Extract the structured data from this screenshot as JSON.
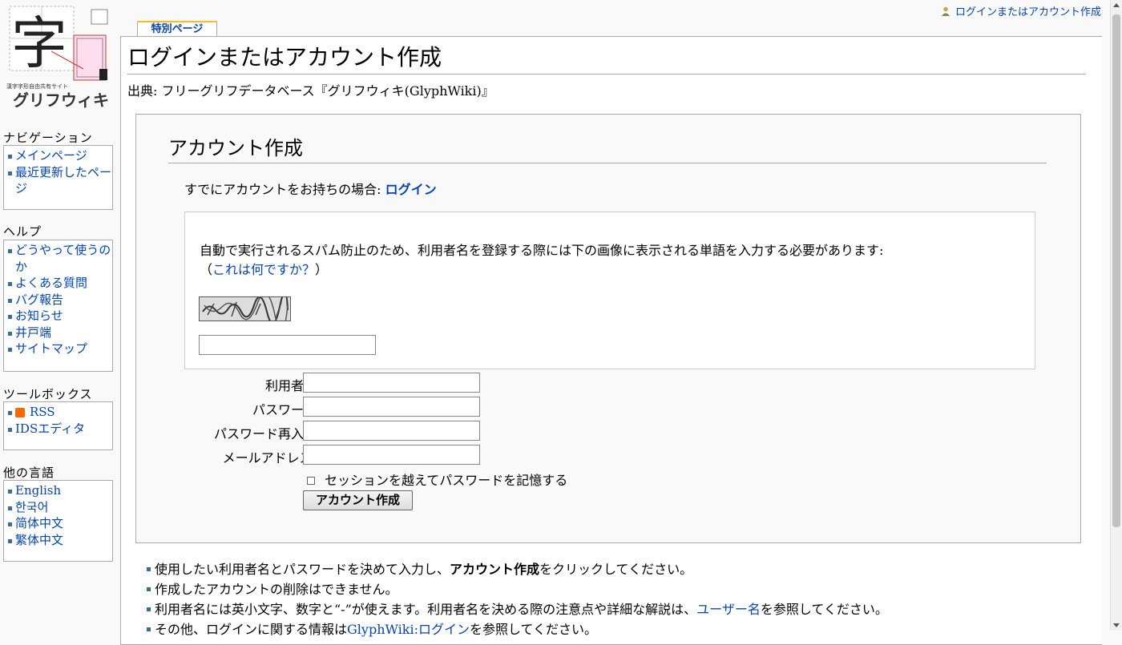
{
  "personal_tools": {
    "login_label": "ログインまたはアカウント作成"
  },
  "logo": {
    "big_char": "字",
    "subtitle": "漢字字形自由共有サイト",
    "name": "グリフウィキ"
  },
  "tabs": {
    "special": "特別ページ"
  },
  "page": {
    "title": "ログインまたはアカウント作成",
    "site_sub": "出典: フリーグリフデータベース『グリフウィキ(GlyphWiki)』"
  },
  "form": {
    "heading": "アカウント作成",
    "have_account_text": "すでにアカウントをお持ちの場合: ",
    "login_link": "ログイン",
    "captcha_text": "自動で実行されるスパム防止のため、利用者名を登録する際には下の画像に表示される単語を入力する必要があります:",
    "captcha_open": "（",
    "captcha_link": "これは何ですか？",
    "captcha_close": "）",
    "username_label": "利用者名",
    "password_label": "パスワード",
    "password_retype_label": "パスワード再入力",
    "email_label": "メールアドレス:",
    "remember_label": "セッションを越えてパスワードを記憶する",
    "submit_label": "アカウント作成"
  },
  "notes": {
    "n1_pre": "使用したい利用者名とパスワードを決めて入力し、",
    "n1_bold": "アカウント作成",
    "n1_post": "をクリックしてください。",
    "n2": "作成したアカウントの削除はできません。",
    "n3_pre": "利用者名には英小文字、数字と“-”が使えます。利用者名を決める際の注意点や詳細な解説は、",
    "n3_link": "ユーザー名",
    "n3_post": "を参照してください。",
    "n4_pre": "その他、ログインに関する情報は",
    "n4_link": "GlyphWiki:ログイン",
    "n4_post": "を参照してください。"
  },
  "sidebar": {
    "navigation": {
      "title": "ナビゲーション",
      "items": [
        "メインページ",
        "最近更新したページ"
      ]
    },
    "help": {
      "title": "ヘルプ",
      "items": [
        "どうやって使うのか",
        "よくある質問",
        "バグ報告",
        "お知らせ",
        "井戸端",
        "サイトマップ"
      ]
    },
    "toolbox": {
      "title": "ツールボックス",
      "items": [
        "RSS",
        "IDSエディタ"
      ]
    },
    "languages": {
      "title": "他の言語",
      "items": [
        "English",
        "한국어",
        "简体中文",
        "繁体中文"
      ]
    }
  },
  "colors": {
    "link": "#0645ad",
    "tab_accent": "#fabd23",
    "bullet": "#3a6e8f"
  }
}
